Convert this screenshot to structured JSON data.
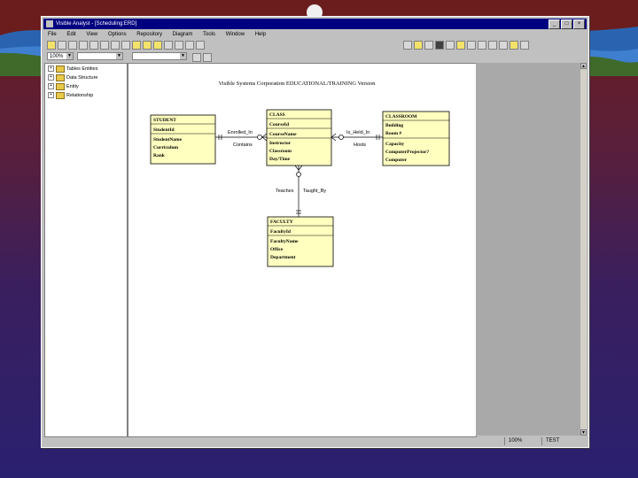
{
  "window": {
    "title": "Visible Analyst - [Scheduling:ERD]",
    "buttons": [
      "_",
      "□",
      "×"
    ]
  },
  "menu": [
    "File",
    "Edit",
    "View",
    "Options",
    "Repository",
    "Diagram",
    "Tools",
    "Window",
    "Help"
  ],
  "toolbar": {
    "zoom": "100%"
  },
  "tree": {
    "items": [
      "Tables Entities",
      "Data Structure",
      "Entity",
      "Relationship"
    ]
  },
  "diagram": {
    "title": "Visible Systems Corporation EDUCATIONAL/TRAINING Version",
    "entities": {
      "student": {
        "name": "STUDENT",
        "pk": [
          "StudentId"
        ],
        "attrs": [
          "StudentName",
          "Curriculum",
          "Rank"
        ]
      },
      "class": {
        "name": "CLASS",
        "pk": [
          "CourseId"
        ],
        "mid": [
          "CourseName"
        ],
        "attrs": [
          "Instructor",
          "Classroom",
          "Day/Time"
        ]
      },
      "classroom": {
        "name": "CLASSROOM",
        "pk": [
          "Building",
          "Room #"
        ],
        "attrs": [
          "Capacity",
          "ComputerProjector?",
          "Computer"
        ]
      },
      "faculty": {
        "name": "FACULTY",
        "pk": [
          "FacultyId"
        ],
        "attrs": [
          "FacultyName",
          "Office",
          "Department"
        ]
      }
    },
    "relations": {
      "enrolled_in": "Enrolled_In",
      "contains": "Contains",
      "is_held_in": "Is_Held_In",
      "hosts": "Hosts",
      "teaches": "Teaches",
      "taught_by": "Taught_By"
    }
  },
  "status": {
    "zoom": "100%",
    "mode": "TEST"
  },
  "colors": {
    "entity_fill": "#ffffc0",
    "title_bar": "#000080"
  }
}
